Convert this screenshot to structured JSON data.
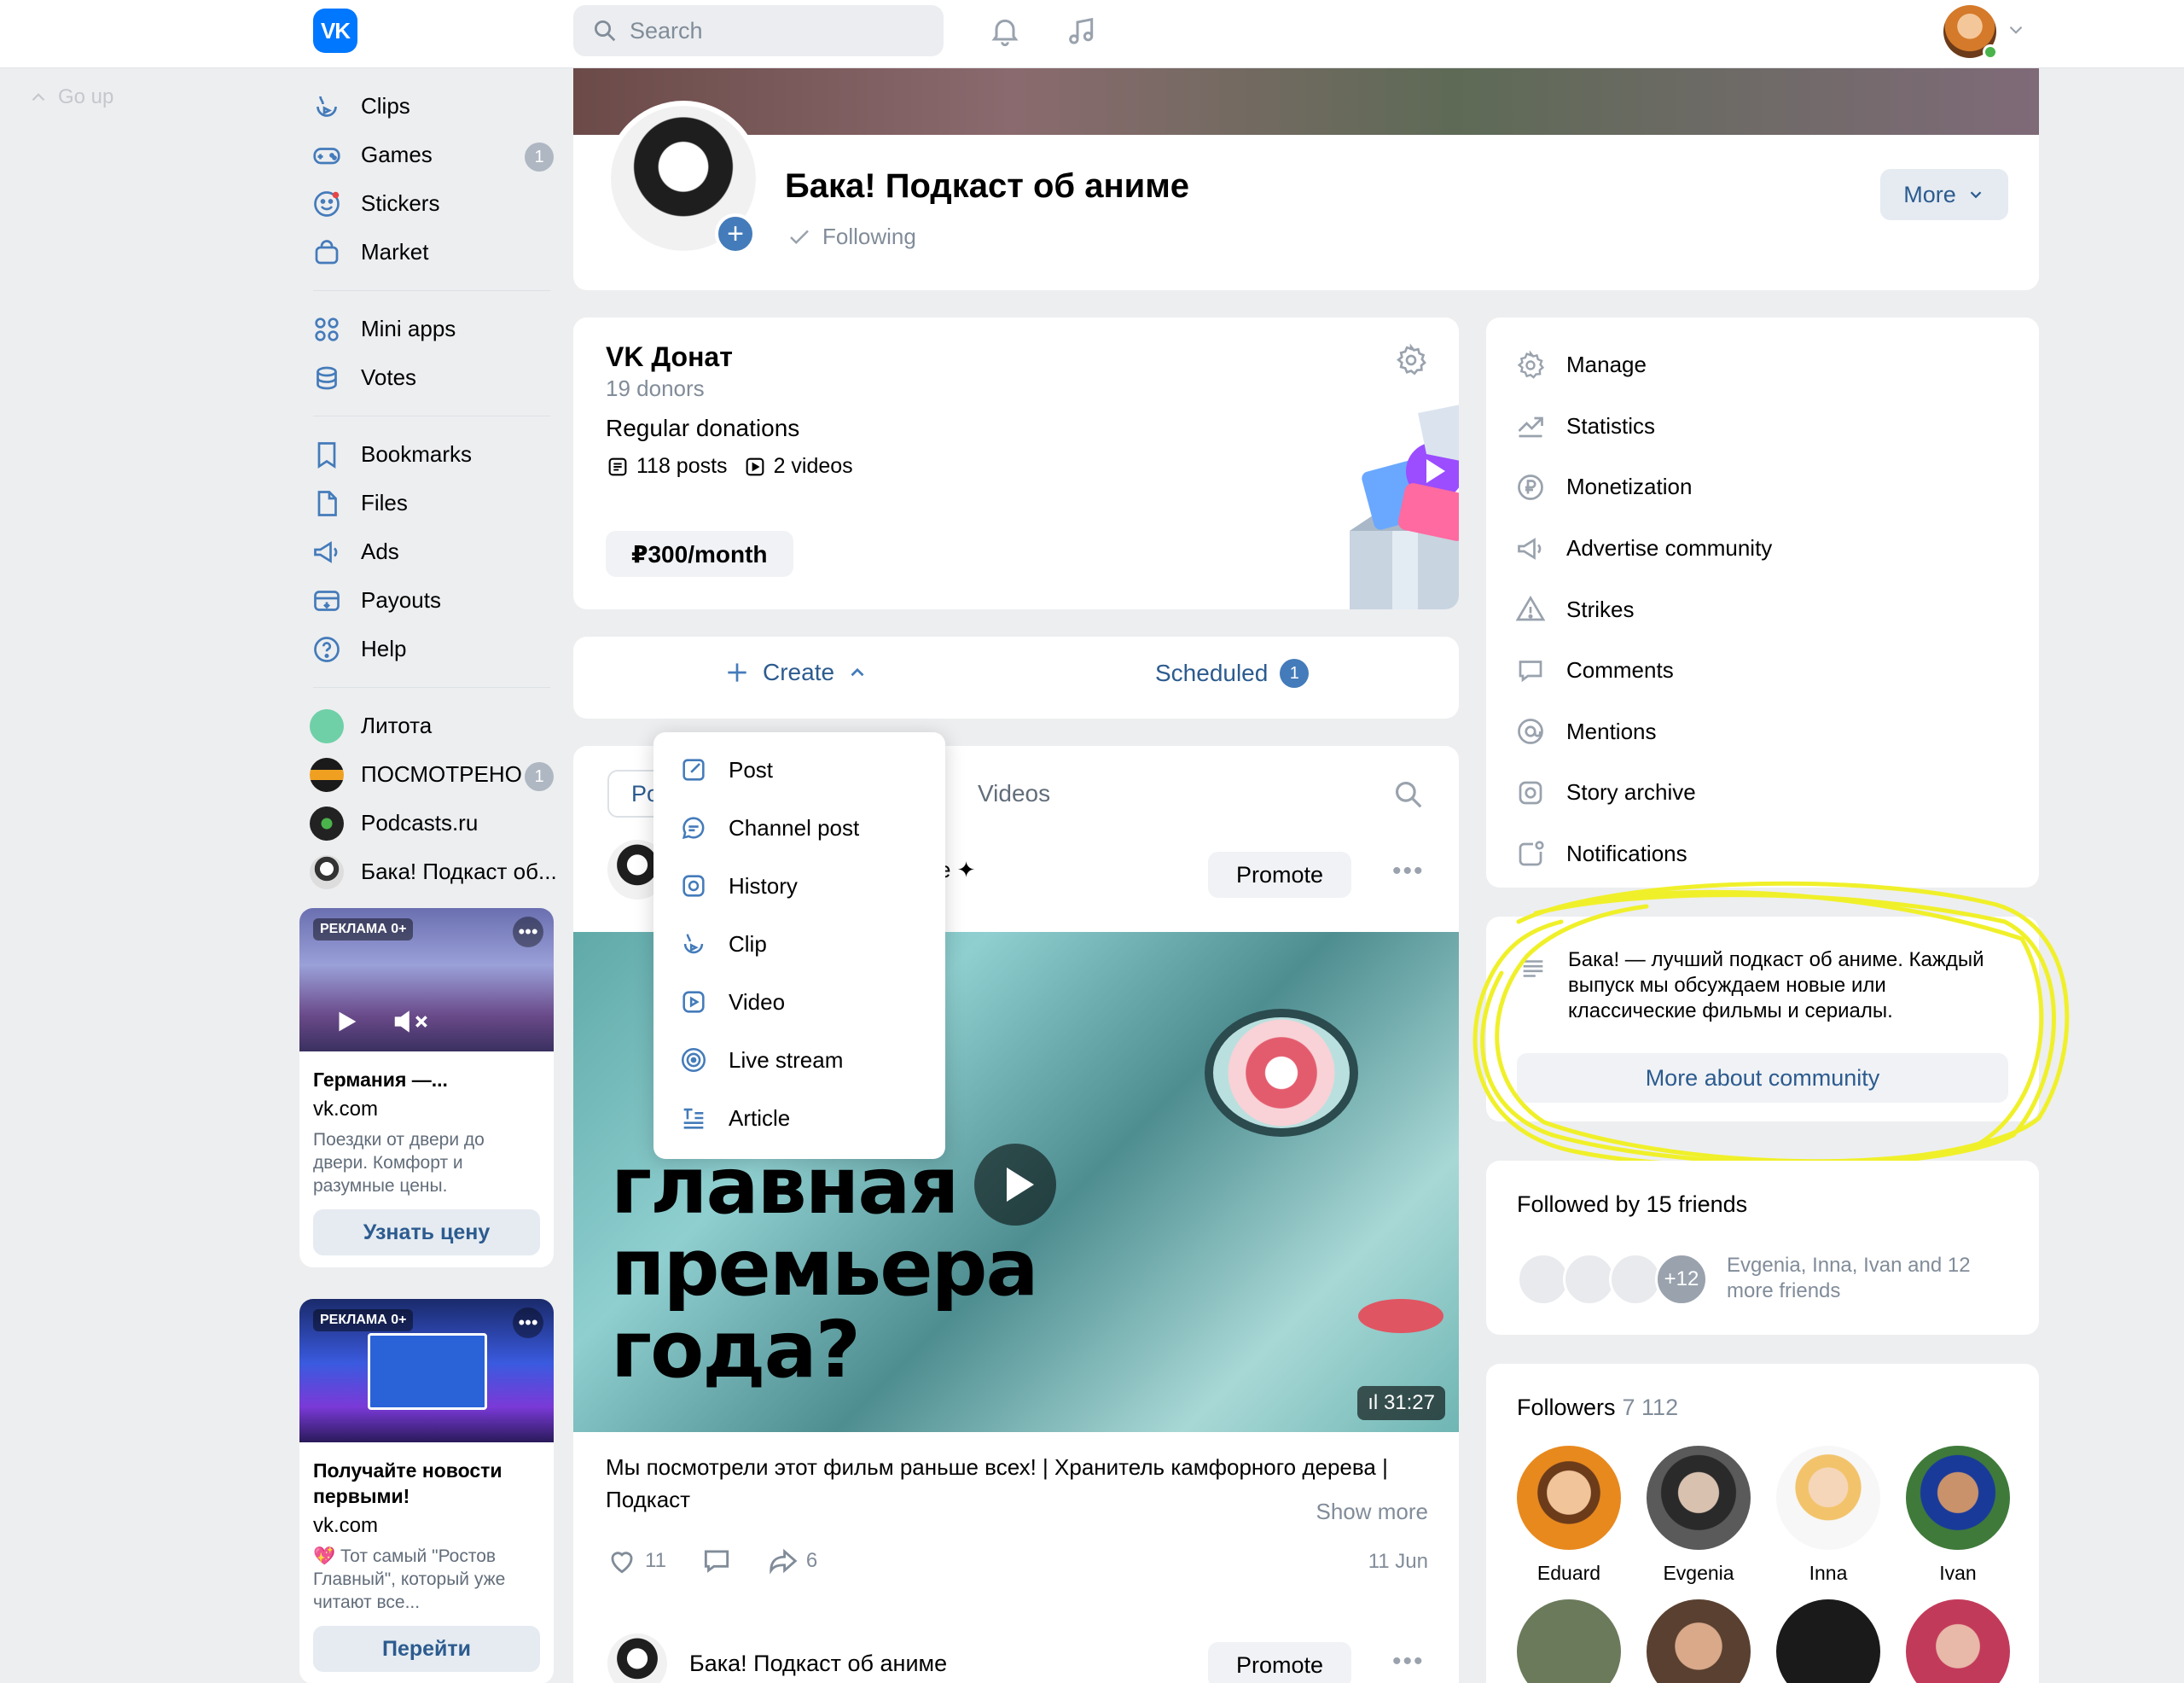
{
  "topbar": {
    "search_placeholder": "Search"
  },
  "go_up": "Go up",
  "nav": {
    "group1": [
      {
        "label": "Clips",
        "icon": "clips-icon"
      },
      {
        "label": "Games",
        "icon": "gamepad-icon",
        "badge": "1"
      },
      {
        "label": "Stickers",
        "icon": "sticker-icon"
      },
      {
        "label": "Market",
        "icon": "shopping-bag-icon"
      }
    ],
    "group2": [
      {
        "label": "Mini apps",
        "icon": "grid-icon"
      },
      {
        "label": "Votes",
        "icon": "coins-icon"
      }
    ],
    "group3": [
      {
        "label": "Bookmarks",
        "icon": "bookmark-icon"
      },
      {
        "label": "Files",
        "icon": "file-icon"
      },
      {
        "label": "Ads",
        "icon": "megaphone-icon"
      },
      {
        "label": "Payouts",
        "icon": "payout-icon"
      },
      {
        "label": "Help",
        "icon": "help-icon"
      }
    ],
    "communities": [
      {
        "label": "Литота",
        "color": "#6fd0a8"
      },
      {
        "label": "ПОСМОТРЕНО",
        "color": "#1a1a1a",
        "badge": "1"
      },
      {
        "label": "Podcasts.ru",
        "color": "#222222"
      },
      {
        "label": "Бака! Подкаст об...",
        "color": "#dddddd"
      }
    ]
  },
  "ads": [
    {
      "tag": "РЕКЛАМА 0+",
      "title": "Германия —...",
      "domain": "vk.com",
      "description": "Поездки от двери до двери. Комфорт и разумные цены.",
      "button": "Узнать цену"
    },
    {
      "tag": "РЕКЛАМА 0+",
      "title": "Получайте новости первыми!",
      "domain": "vk.com",
      "description": "💖 Тот самый \"Ростов Главный\", который уже читают все...",
      "button": "Перейти"
    }
  ],
  "profile": {
    "name": "Бака! Подкаст об аниме",
    "following": "Following",
    "more": "More"
  },
  "donat": {
    "title": "VK Донат",
    "donors": "19 donors",
    "tier": "Regular donations",
    "posts": "118 posts",
    "videos": "2 videos",
    "price": "₽300/month"
  },
  "create_bar": {
    "create": "Create",
    "scheduled": "Scheduled",
    "scheduled_count": "1"
  },
  "create_menu": [
    {
      "label": "Post",
      "icon": "edit-icon"
    },
    {
      "label": "Channel post",
      "icon": "chat-icon"
    },
    {
      "label": "History",
      "icon": "story-icon"
    },
    {
      "label": "Clip",
      "icon": "clips-icon"
    },
    {
      "label": "Video",
      "icon": "video-icon"
    },
    {
      "label": "Live stream",
      "icon": "live-icon"
    },
    {
      "label": "Article",
      "icon": "article-icon"
    }
  ],
  "feed": {
    "tab_posts": "Po",
    "tab_videos": "Videos",
    "promote": "Promote",
    "video_title_lines": [
      "главная",
      "премьера",
      "года?"
    ],
    "duration": "31:27",
    "post_text": "Мы посмотрели этот фильм раньше всех! | Хранитель камфорного дерева | Подкаст",
    "show_more": "Show more",
    "likes": "11",
    "shares": "6",
    "date": "11 Jun",
    "post2_author": "Бака! Подкаст об аниме"
  },
  "manage_menu": [
    {
      "label": "Manage",
      "icon": "gear-icon"
    },
    {
      "label": "Statistics",
      "icon": "chart-icon"
    },
    {
      "label": "Monetization",
      "icon": "ruble-icon"
    },
    {
      "label": "Advertise community",
      "icon": "megaphone-icon"
    },
    {
      "label": "Strikes",
      "icon": "warning-icon"
    },
    {
      "label": "Comments",
      "icon": "comment-icon"
    },
    {
      "label": "Mentions",
      "icon": "at-icon"
    },
    {
      "label": "Story archive",
      "icon": "story-icon"
    },
    {
      "label": "Notifications",
      "icon": "notification-icon"
    }
  ],
  "about": {
    "text": "Бака! — лучший подкаст об аниме. Каждый выпуск мы обсуждаем новые или классические фильмы и сериалы.",
    "button": "More about community"
  },
  "friends": {
    "title": "Followed by 15 friends",
    "more_count": "+12",
    "names": "Evgenia, Inna, Ivan and 12 more friends"
  },
  "followers": {
    "title": "Followers",
    "count": "7 112",
    "people": [
      {
        "name": "Eduard",
        "color": "#e8891e"
      },
      {
        "name": "Evgenia",
        "color": "#5a5a5a"
      },
      {
        "name": "Inna",
        "color": "#f3d7b5"
      },
      {
        "name": "Ivan",
        "color": "#3f7a3a"
      }
    ]
  },
  "colors": {
    "accent": "#2c5b8f",
    "brand": "#0077ff",
    "badge": "#447bba",
    "highlight": "#f0f02a"
  }
}
